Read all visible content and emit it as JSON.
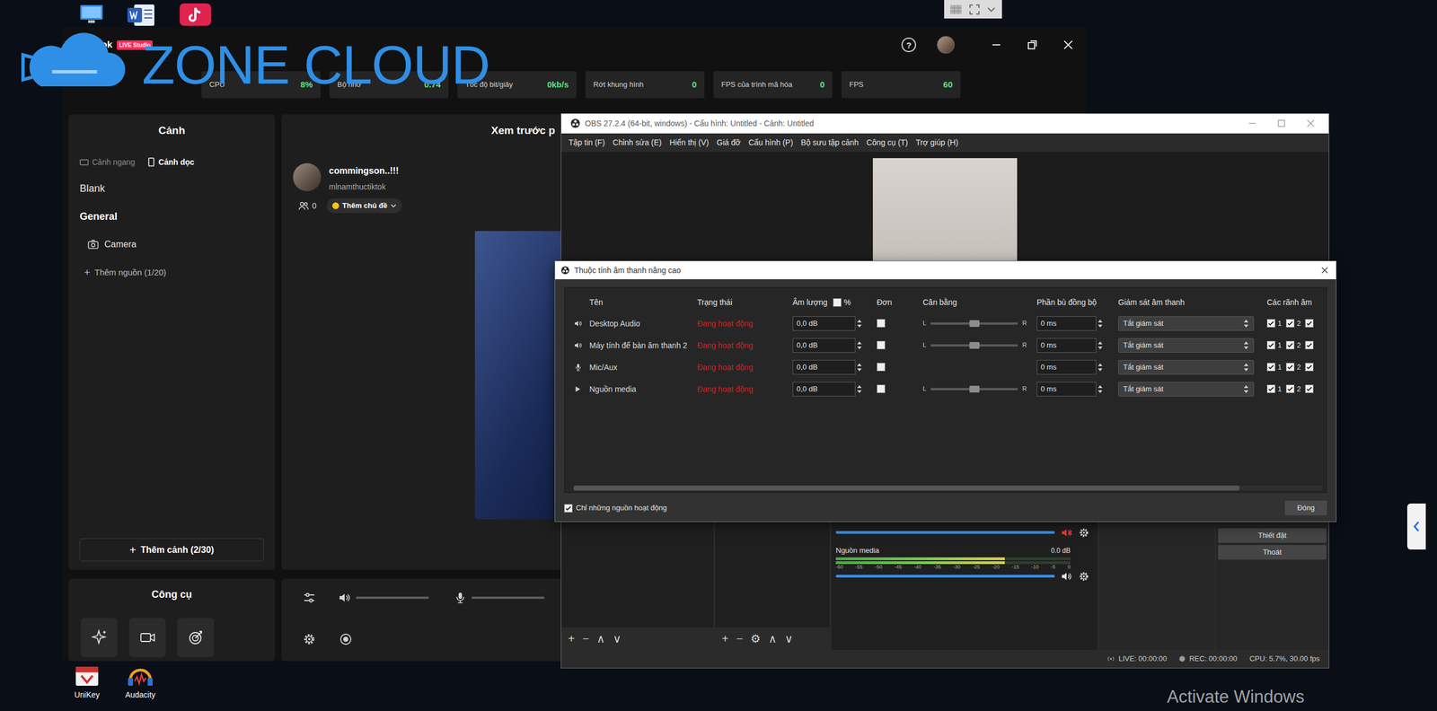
{
  "desktop": {
    "shortcuts": [
      {
        "label": "UniKey"
      },
      {
        "label": "Audacity"
      }
    ],
    "activation_notice": "Activate Windows"
  },
  "watermark": "ZONE CLOUD",
  "tiktok": {
    "title": "TikTok",
    "badge": "LIVE Studio",
    "help": "?",
    "stats": [
      {
        "label": "CPU",
        "value": "8%"
      },
      {
        "label": "Bộ nhớ",
        "value": "0.74"
      },
      {
        "label": "Tốc độ bit/giây",
        "value": "0kb/s"
      },
      {
        "label": "Rớt khung hình",
        "value": "0"
      },
      {
        "label": "FPS của trình mã hóa",
        "value": "0"
      },
      {
        "label": "FPS",
        "value": "60"
      }
    ],
    "scenes": {
      "title": "Cảnh",
      "tabs": [
        {
          "label": "Cảnh ngang",
          "selected": false
        },
        {
          "label": "Cảnh dọc",
          "selected": true
        }
      ],
      "items": [
        {
          "label": "Blank",
          "selected": false,
          "sources": []
        },
        {
          "label": "General",
          "selected": true,
          "sources": [
            {
              "label": "Camera"
            }
          ]
        }
      ],
      "add_source": {
        "icon": "+",
        "label": "Thêm nguồn (1/20)"
      },
      "add_scene": {
        "icon": "+",
        "label": "Thêm cảnh (2/30)"
      }
    },
    "tools": {
      "title": "Công cụ"
    },
    "preview": {
      "title": "Xem trước p",
      "user_name": "commingson..!!!",
      "handle": "mlnamthuctiktok",
      "viewers": "0",
      "topic": "Thêm chủ đề"
    },
    "audio": {
      "speaker_level": 1,
      "mic_level": 1
    }
  },
  "obs": {
    "title": "OBS 27.2.4 (64-bit, windows) - Cấu hình: Untitled - Cảnh: Untitled",
    "menu": [
      "Tập tin (F)",
      "Chỉnh sửa (E)",
      "Hiển thị (V)",
      "Giá đỡ",
      "Cấu hình (P)",
      "Bộ sưu tập cảnh",
      "Công cụ (T)",
      "Trợ giúp (H)"
    ],
    "scene_tools": [
      "+",
      "−",
      "∧",
      "∨"
    ],
    "source_tools": [
      "+",
      "−",
      "⚙",
      "∧",
      "∨"
    ],
    "mixer": [
      {
        "muted": true,
        "level": 1
      },
      {
        "name": "Nguồn media",
        "reading": "0.0 dB",
        "muted": false,
        "level": 1,
        "meter": 0.72
      }
    ],
    "meter_ticks": [
      "-60",
      "-55",
      "-50",
      "-45",
      "-40",
      "-35",
      "-30",
      "-25",
      "-20",
      "-15",
      "-10",
      "-5",
      "0"
    ],
    "controls": [
      "Thiết đặt",
      "Thoát"
    ],
    "status": {
      "live": "LIVE: 00:00:00",
      "rec": "REC: 00:00:00",
      "cpu": "CPU: 5.7%, 30.00 fps"
    }
  },
  "dialog": {
    "title": "Thuộc tính âm thanh nâng cao",
    "columns": [
      "Tên",
      "Trạng thái",
      "Âm lượng",
      "Đơn",
      "Cân bằng",
      "Phần bù đồng bộ",
      "Giám sát âm thanh",
      "Các rãnh âm"
    ],
    "percent": {
      "label": "%",
      "checked": false
    },
    "rows": [
      {
        "name": "Desktop Audio",
        "kind": "output",
        "status": "Đang hoạt động",
        "volume": "0,0 dB",
        "mono": false,
        "balance": 0.5,
        "left": "L",
        "right": "R",
        "sync": "0 ms",
        "monitoring": "Tắt giám sát",
        "tracks": [
          {
            "label": "1",
            "checked": true
          },
          {
            "label": "2",
            "checked": true
          },
          {
            "checked": true
          }
        ]
      },
      {
        "name": "Máy tính để bàn âm thanh 2",
        "kind": "output",
        "status": "Đang hoạt động",
        "volume": "0,0 dB",
        "mono": false,
        "balance": 0.5,
        "left": "L",
        "right": "R",
        "sync": "0 ms",
        "monitoring": "Tắt giám sát",
        "tracks": [
          {
            "label": "1",
            "checked": true
          },
          {
            "label": "2",
            "checked": true
          },
          {
            "checked": true
          }
        ]
      },
      {
        "name": "Mic/Aux",
        "kind": "input",
        "status": "Đang hoạt động",
        "volume": "0,0 dB",
        "mono": false,
        "sync": "0 ms",
        "monitoring": "Tắt giám sát",
        "tracks": [
          {
            "label": "1",
            "checked": true
          },
          {
            "label": "2",
            "checked": true
          },
          {
            "checked": true
          }
        ]
      },
      {
        "name": "Nguồn media",
        "kind": "media",
        "status": "Đang hoạt động",
        "volume": "0,0 dB",
        "mono": false,
        "balance": 0.5,
        "left": "L",
        "right": "R",
        "sync": "0 ms",
        "monitoring": "Tắt giám sát",
        "tracks": [
          {
            "label": "1",
            "checked": true
          },
          {
            "label": "2",
            "checked": true
          },
          {
            "checked": true
          }
        ]
      }
    ],
    "scroll": {
      "level": 0.89
    },
    "active_only": {
      "label": "Chỉ những nguồn hoạt động",
      "checked": true
    },
    "close_button": "Đóng"
  }
}
